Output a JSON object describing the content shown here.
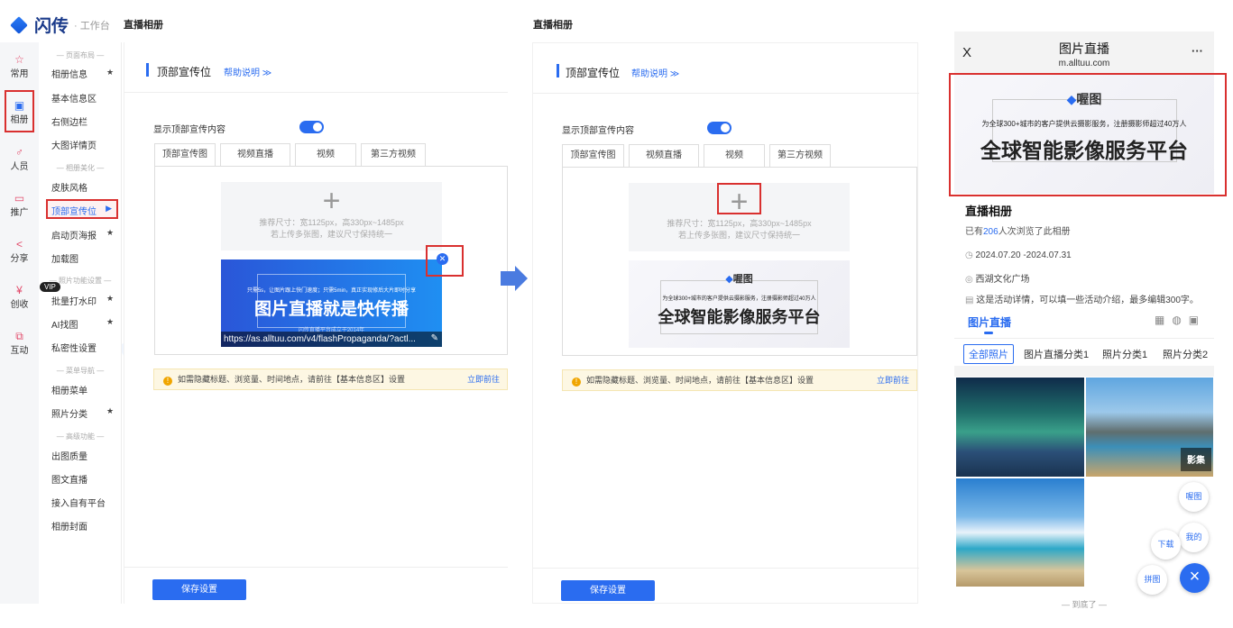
{
  "app": {
    "name": "闪传",
    "subtitle": "· 工作台"
  },
  "left_screen": {
    "breadcrumb": "直播相册",
    "rail": [
      {
        "icon": "star-icon",
        "glyph": "☆",
        "label": "常用"
      },
      {
        "icon": "album-icon",
        "glyph": "▣",
        "label": "相册"
      },
      {
        "icon": "people-icon",
        "glyph": "♂",
        "label": "人员"
      },
      {
        "icon": "promote-icon",
        "glyph": "▭",
        "label": "推广"
      },
      {
        "icon": "share-icon",
        "glyph": "<",
        "label": "分享"
      },
      {
        "icon": "revenue-icon",
        "glyph": "¥",
        "label": "创收"
      },
      {
        "icon": "interact-icon",
        "glyph": "⧉",
        "label": "互动"
      }
    ],
    "submenu": {
      "sec1": "— 页面布局 —",
      "item1": "相册信息",
      "item2": "基本信息区",
      "item3": "右侧边栏",
      "item4": "大图详情页",
      "sec2": "— 相册美化 —",
      "item5": "皮肤风格",
      "item6": "顶部宣传位",
      "item7": "启动页海报",
      "item8": "加载图",
      "sec3": "— 照片功能设置 —",
      "vip": "VIP",
      "item9": "批量打水印",
      "item10": "AI找图",
      "item11": "私密性设置",
      "sec4": "— 菜单导航 —",
      "item12": "相册菜单",
      "item13": "照片分类",
      "sec5": "— 高级功能 —",
      "item14": "出图质量",
      "item15": "图文直播",
      "item16": "接入自有平台",
      "item17": "相册封面",
      "star": "★",
      "arrow": "▶"
    },
    "panel": {
      "title": "顶部宣传位",
      "help": "帮助说明 ≫",
      "toggle_label": "显示顶部宣传内容",
      "tabs": [
        "顶部宣传图",
        "视频直播",
        "视频",
        "第三方视频"
      ],
      "upload_hint1": "推荐尺寸：宽1125px，高330px~1485px",
      "upload_hint2": "若上传多张图，建议尺寸保持统一",
      "banner_top": "只需5s，让图片跟上快门速度；只需5min，真正实现修后大片即时分享",
      "banner_main": "图片直播就是快传播",
      "banner_foot": "闪传直播平台成立于2014年",
      "banner_url": "https://as.alltuu.com/v4/flashPropaganda/?actl...",
      "notice": "如需隐藏标题、浏览量、时间地点，请前往【基本信息区】设置",
      "notice_link": "立即前往",
      "save": "保存设置"
    }
  },
  "middle_screen": {
    "breadcrumb": "直播相册",
    "panel": {
      "title": "顶部宣传位",
      "help": "帮助说明 ≫",
      "toggle_label": "显示顶部宣传内容",
      "tabs": [
        "顶部宣传图",
        "视频直播",
        "视频",
        "第三方视频"
      ],
      "upload_hint1": "推荐尺寸：宽1125px，高330px~1485px",
      "upload_hint2": "若上传多张图，建议尺寸保持统一",
      "banner_brand": "喔图",
      "banner_sub": "为全球300+城市的客户提供云摄影服务，注册摄影师超过40万人",
      "banner_main": "全球智能影像服务平台",
      "notice": "如需隐藏标题、浏览量、时间地点，请前往【基本信息区】设置",
      "notice_link": "立即前往",
      "save": "保存设置"
    }
  },
  "phone": {
    "close": "X",
    "title": "图片直播",
    "url": "m.alltuu.com",
    "more": "···",
    "banner_brand": "喔图",
    "banner_sub": "为全球300+城市的客户提供云摄影服务，注册摄影师超过40万人",
    "banner_main": "全球智能影像服务平台",
    "album_title": "直播相册",
    "views_prefix": "已有",
    "views_count": "206",
    "views_suffix": "人次浏览了此相册",
    "date": "2024.07.20 -2024.07.31",
    "location": "西湖文化广场",
    "desc": "这是活动详情，可以填一些活动介绍，最多编辑300字。",
    "tab_title": "图片直播",
    "categories": [
      "全部照片",
      "图片直播分类1",
      "照片分类1",
      "照片分类2"
    ],
    "badge": "影集",
    "fab_woto": "喔图",
    "fab_mine": "我的",
    "fab_download": "下载",
    "fab_collage": "拼图",
    "fab_close": "×",
    "footer": "—  到底了  —"
  },
  "watermark": "喔图",
  "colors": {
    "accent": "#2a6cf0",
    "highlight": "#d9302f",
    "notice_bg": "#fdf7e3"
  }
}
